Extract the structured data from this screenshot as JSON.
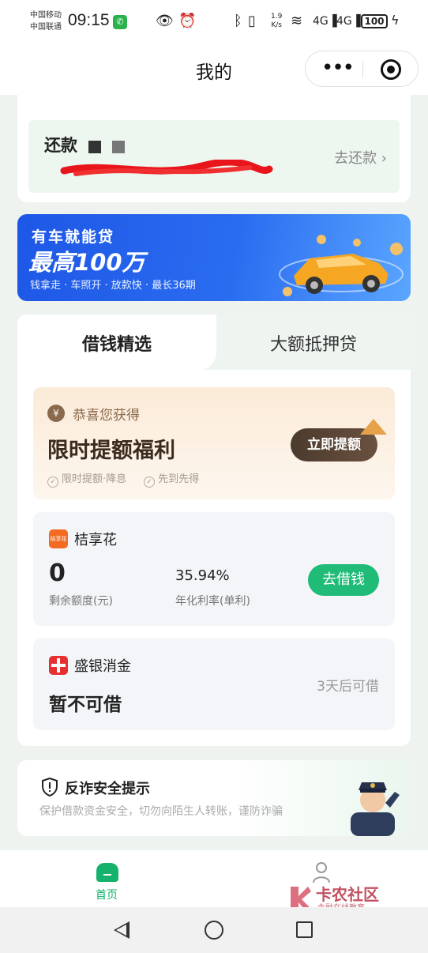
{
  "status_bar": {
    "carrier1": "中国移动",
    "carrier2": "中国联通",
    "time": "09:15",
    "net_speed_value": "1.9",
    "net_speed_unit": "K/s",
    "battery": "100",
    "icons": [
      "phone-icon",
      "eye-icon",
      "alarm-icon",
      "bluetooth-icon",
      "vibrate-icon",
      "wifi-icon",
      "signal-4g-icon",
      "signal-4g-icon",
      "charging-icon"
    ]
  },
  "header": {
    "title": "我的",
    "menu_icon": "more-dots-icon",
    "close_icon": "target-icon"
  },
  "repay_card": {
    "title": "还款",
    "action": "去还款 ›"
  },
  "banner": {
    "tag": "有车就能贷",
    "headline": "最高100万",
    "subline": "钱拿走 · 车照开 · 放款快 · 最长36期"
  },
  "tabs": [
    {
      "label": "借钱精选",
      "active": true
    },
    {
      "label": "大额抵押贷",
      "active": false
    }
  ],
  "promo": {
    "icon_text": "¥",
    "greeting": "恭喜您获得",
    "title": "限时提额福利",
    "tag1": "限时提额·降息",
    "tag2": "先到先得",
    "button": "立即提额"
  },
  "loans": [
    {
      "brand": "桔享花",
      "logo_text": "桔享花",
      "credit_value": "0",
      "credit_label": "剩余额度(元)",
      "rate_value": "35.94%",
      "rate_label": "年化利率(单利)",
      "button": "去借钱"
    },
    {
      "brand": "盛银消金",
      "status": "暂不可借",
      "note": "3天后可借"
    }
  ],
  "safety": {
    "title": "反诈安全提示",
    "text": "保护借款资金安全，切勿向陌生人转账，谨防诈骗"
  },
  "tabbar": {
    "home_label": "首页"
  },
  "watermark": {
    "title": "卡农社区",
    "subtitle": "金融在线教育"
  },
  "colors": {
    "accent_green": "#14b26a",
    "button_green": "#1fbb77",
    "banner_blue": "#2a6cf0",
    "promo_brown": "#4b3a2d"
  }
}
